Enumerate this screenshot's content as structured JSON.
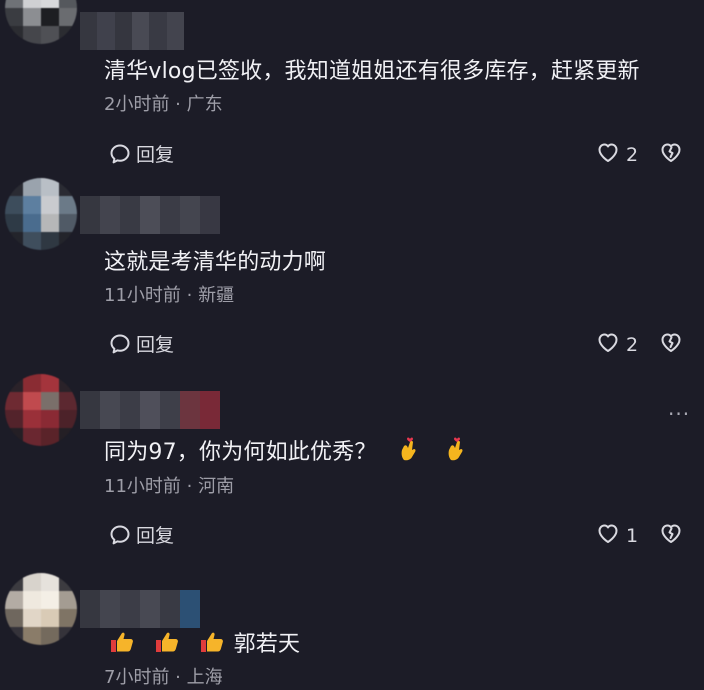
{
  "comments": [
    {
      "content": "清华vlog已签收，我知道姐姐还有很多库存，赶紧更新",
      "meta": "2小时前 · 广东",
      "reply_label": "回复",
      "likes": "2"
    },
    {
      "content": "这就是考清华的动力啊",
      "meta": "11小时前 · 新疆",
      "reply_label": "回复",
      "likes": "2"
    },
    {
      "content": "同为97，你为何如此优秀？",
      "meta": "11小时前 · 河南",
      "reply_label": "回复",
      "likes": "1",
      "more_label": "···"
    },
    {
      "content": "郭若天",
      "meta": "7小时前 · 上海"
    }
  ],
  "icons": {
    "reply": "speech-bubble-icon",
    "like": "heart-outline-icon",
    "dislike": "broken-heart-icon",
    "more": "ellipsis-icon",
    "finger_heart": "finger-heart-emoji",
    "thumbs_up": "thumbs-up-emoji"
  },
  "colors": {
    "background": "#1c1c27",
    "text_primary": "#f1f1f5",
    "text_secondary": "#9e9ea8"
  }
}
